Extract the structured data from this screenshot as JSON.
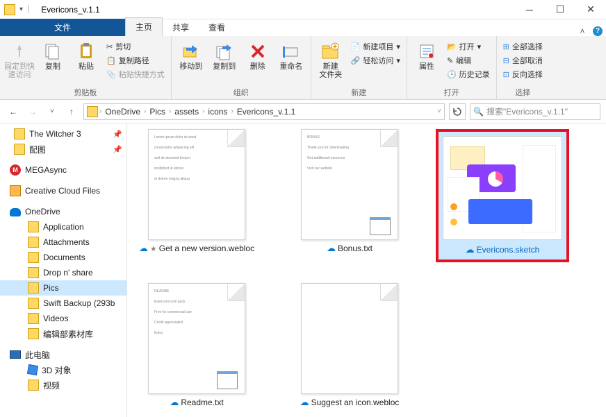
{
  "window": {
    "title": "Evericons_v.1.1"
  },
  "tabs": {
    "file": "文件",
    "home": "主页",
    "share": "共享",
    "view": "查看"
  },
  "ribbon": {
    "clipboard": {
      "label": "剪贴板",
      "pin": "固定到快\n速访问",
      "copy": "复制",
      "paste": "粘贴",
      "cut": "剪切",
      "copypath": "复制路径",
      "pasteshortcut": "粘贴快捷方式"
    },
    "organize": {
      "label": "组织",
      "moveto": "移动到",
      "copyto": "复制到",
      "delete": "删除",
      "rename": "重命名"
    },
    "new": {
      "label": "新建",
      "newfolder": "新建\n文件夹",
      "newitem": "新建项目",
      "easyaccess": "轻松访问"
    },
    "open": {
      "label": "打开",
      "props": "属性",
      "open": "打开",
      "edit": "编辑",
      "history": "历史记录"
    },
    "select": {
      "label": "选择",
      "all": "全部选择",
      "none": "全部取消",
      "invert": "反向选择"
    }
  },
  "breadcrumbs": [
    "OneDrive",
    "Pics",
    "assets",
    "icons",
    "Evericons_v.1.1"
  ],
  "search": {
    "placeholder": "搜索\"Evericons_v.1.1\""
  },
  "tree": {
    "witcher": "The Witcher 3",
    "peitu": "配图",
    "mega": "MEGAsync",
    "ccf": "Creative Cloud Files",
    "onedrive": "OneDrive",
    "application": "Application",
    "attachments": "Attachments",
    "documents": "Documents",
    "dropshare": "Drop n' share",
    "pics": "Pics",
    "swift": "Swift Backup (293b",
    "videos": "Videos",
    "bianji": "编辑部素材库",
    "thispc": "此电脑",
    "threedobj": "3D 对象",
    "shipin": "视频"
  },
  "files": {
    "getnew": "Get a new version.webloc",
    "bonus": "Bonus.txt",
    "evericons": "Evericons.sketch",
    "readme": "Readme.txt",
    "suggest": "Suggest an icon.webloc"
  }
}
